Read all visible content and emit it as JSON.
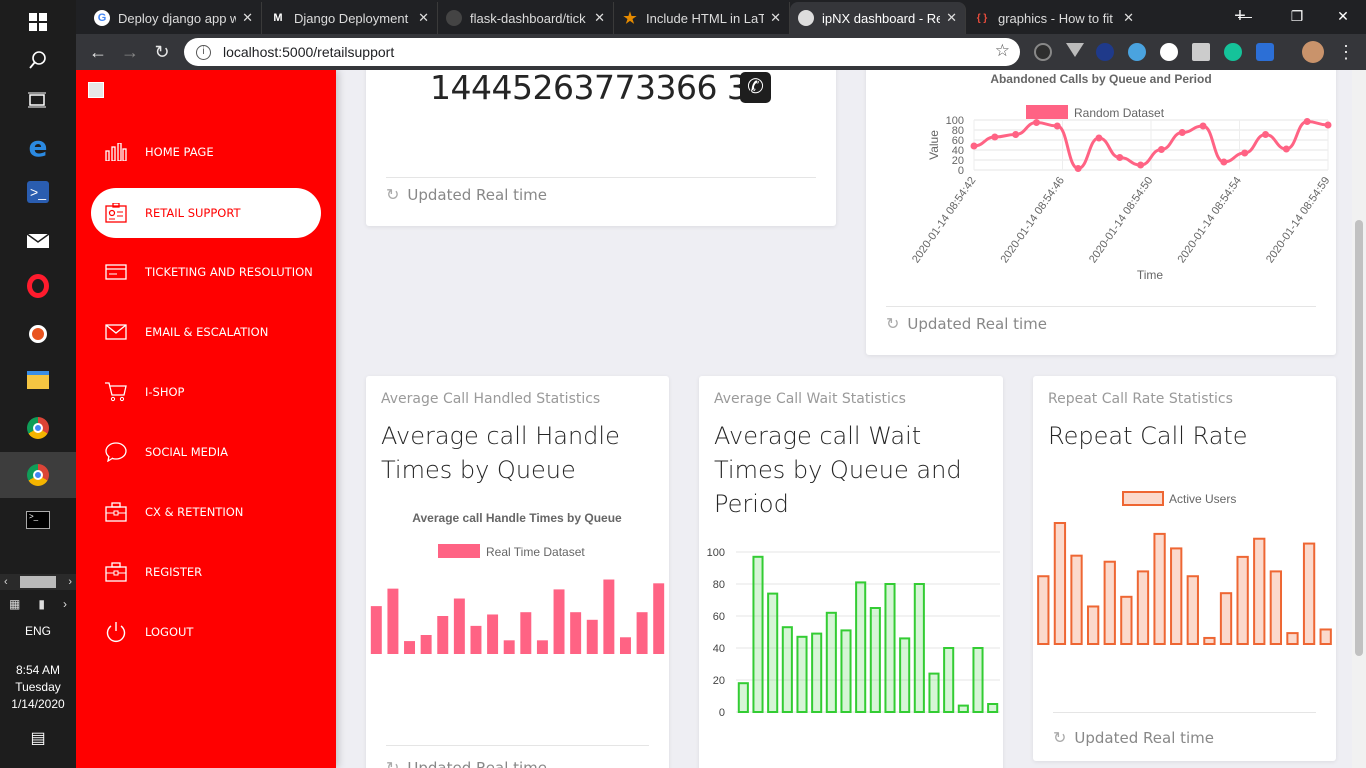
{
  "taskbar": {
    "language": "ENG",
    "time": "8:54 AM",
    "day": "Tuesday",
    "date": "1/14/2020"
  },
  "browser": {
    "tabs": [
      {
        "title": "Deploy django app w",
        "fav_color": "#ffffff",
        "fav_text": "G"
      },
      {
        "title": "Django Deployment (",
        "fav_color": "#ffffff",
        "fav_text": "M"
      },
      {
        "title": "flask-dashboard/tick",
        "fav_color": "#444444",
        "fav_text": ""
      },
      {
        "title": "Include HTML in LaTe",
        "fav_color": "#e58a00",
        "fav_text": "★"
      },
      {
        "title": "ipNX dashboard - Re",
        "fav_color": "#dddddd",
        "fav_text": ""
      },
      {
        "title": "graphics - How to fit",
        "fav_color": "#c0392b",
        "fav_text": "{ }"
      }
    ],
    "url": "localhost:5000/retailsupport"
  },
  "sidebar": {
    "items": [
      {
        "label": "HOME PAGE",
        "icon": "bar-chart-icon"
      },
      {
        "label": "RETAIL SUPPORT",
        "icon": "id-card-icon"
      },
      {
        "label": "TICKETING AND RESOLUTION",
        "icon": "card-icon"
      },
      {
        "label": "EMAIL & ESCALATION",
        "icon": "envelope-icon"
      },
      {
        "label": "I-SHOP",
        "icon": "cart-icon"
      },
      {
        "label": "SOCIAL MEDIA",
        "icon": "chat-bubble-icon"
      },
      {
        "label": "CX & RETENTION",
        "icon": "briefcase-icon"
      },
      {
        "label": "REGISTER",
        "icon": "briefcase-icon"
      },
      {
        "label": "LOGOUT",
        "icon": "power-icon"
      }
    ]
  },
  "calls_card": {
    "number": "14445263773366 3",
    "updated": "Updated Real time"
  },
  "abandoned_card": {
    "updated": "Updated Real time"
  },
  "handle_card": {
    "category": "Average Call Handled Statistics",
    "title": "Average call Handle Times by Queue",
    "updated": "Updated Real time"
  },
  "wait_card": {
    "category": "Average Call Wait Statistics",
    "title": "Average call Wait Times by Queue and Period"
  },
  "repeat_card": {
    "category": "Repeat Call Rate Statistics",
    "title": "Repeat Call Rate",
    "updated": "Updated Real time"
  },
  "colors": {
    "sidebar": "#ff0000",
    "pink": "#ff6384",
    "green": "#33cc33",
    "orange": "#ee6633"
  },
  "chart_data": [
    {
      "type": "line",
      "title": "Abandoned Calls by Queue and Period",
      "xlabel": "Time",
      "ylabel": "Value",
      "ylim": [
        0,
        100
      ],
      "yticks": [
        0,
        20,
        40,
        60,
        80,
        100
      ],
      "x_ticks": [
        "2020-01-14 08:54:42",
        "2020-01-14 08:54:46",
        "2020-01-14 08:54:50",
        "2020-01-14 08:54:54",
        "2020-01-14 08:54:59"
      ],
      "series": [
        {
          "name": "Random Dataset",
          "values": [
            48,
            66,
            71,
            95,
            88,
            3,
            64,
            25,
            10,
            41,
            75,
            88,
            16,
            34,
            71,
            42,
            97,
            90
          ]
        }
      ],
      "legend": "top"
    },
    {
      "type": "bar",
      "title": "Average call Handle Times by Queue",
      "series": [
        {
          "name": "Real Time Dataset",
          "values": [
            63,
            86,
            17,
            25,
            50,
            73,
            37,
            52,
            18,
            55,
            18,
            85,
            55,
            45,
            98,
            22,
            55,
            93
          ]
        }
      ],
      "legend": "top"
    },
    {
      "type": "bar",
      "ylim": [
        0,
        100
      ],
      "yticks": [
        0,
        20,
        40,
        60,
        80,
        100
      ],
      "series": [
        {
          "values": [
            18,
            97,
            74,
            53,
            47,
            49,
            62,
            51,
            81,
            65,
            80,
            46,
            80,
            24,
            40,
            4,
            40,
            5
          ]
        }
      ],
      "grid": true
    },
    {
      "type": "bar",
      "series": [
        {
          "name": "Active Users",
          "values": [
            56,
            100,
            73,
            31,
            68,
            39,
            60,
            91,
            79,
            56,
            5,
            42,
            72,
            87,
            60,
            9,
            83,
            12
          ]
        }
      ],
      "legend": "top"
    }
  ]
}
